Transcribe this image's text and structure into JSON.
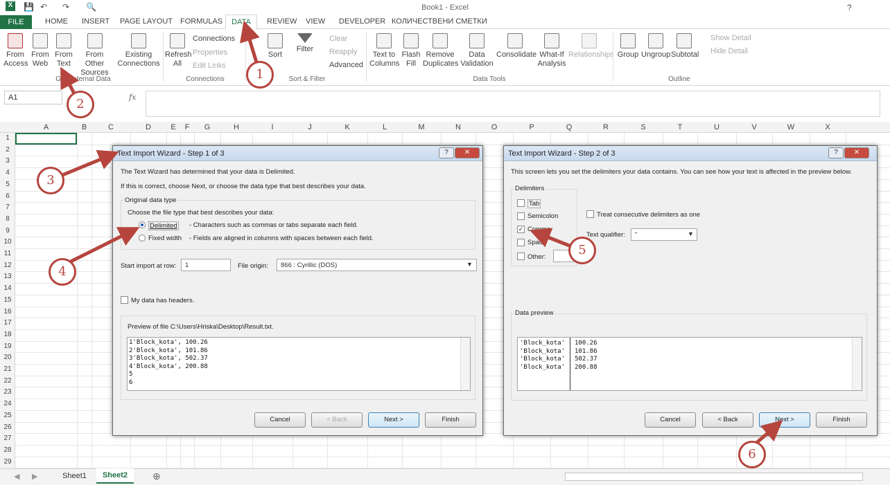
{
  "title": "Book1 - Excel",
  "help_glyph": "?",
  "tabs": [
    "FILE",
    "HOME",
    "INSERT",
    "PAGE LAYOUT",
    "FORMULAS",
    "DATA",
    "REVIEW",
    "VIEW",
    "DEVELOPER",
    "КОЛИЧЕСТВЕНИ СМЕТКИ"
  ],
  "ribbon": {
    "get_external": {
      "from_access": "From\nAccess",
      "from_web": "From\nWeb",
      "from_text": "From\nText",
      "from_other": "From Other\nSources",
      "existing": "Existing\nConnections",
      "group": "Get External Data"
    },
    "connections": {
      "refresh": "Refresh\nAll",
      "connections": "Connections",
      "properties": "Properties",
      "edit_links": "Edit Links",
      "group": "Connections"
    },
    "sort_filter": {
      "sort": "Sort",
      "filter": "Filter",
      "clear": "Clear",
      "reapply": "Reapply",
      "advanced": "Advanced",
      "group": "Sort & Filter"
    },
    "data_tools": {
      "text_to_columns": "Text to\nColumns",
      "flash_fill": "Flash\nFill",
      "remove_dup": "Remove\nDuplicates",
      "data_validation": "Data\nValidation",
      "consolidate": "Consolidate",
      "what_if": "What-If\nAnalysis",
      "relationships": "Relationships",
      "group": "Data Tools"
    },
    "outline": {
      "group_btn": "Group",
      "ungroup": "Ungroup",
      "subtotal": "Subtotal",
      "show_detail": "Show Detail",
      "hide_detail": "Hide Detail",
      "group": "Outline"
    }
  },
  "namebox": "A1",
  "fx": "fx",
  "columns": [
    "A",
    "B",
    "C",
    "D",
    "E",
    "F",
    "G",
    "H",
    "I",
    "J",
    "K",
    "L",
    "M",
    "N",
    "O",
    "P",
    "Q",
    "R",
    "S",
    "T",
    "U",
    "V",
    "W",
    "X"
  ],
  "rows": [
    "1",
    "2",
    "3",
    "4",
    "5",
    "6",
    "7",
    "8",
    "9",
    "10",
    "11",
    "12",
    "13",
    "14",
    "15",
    "16",
    "17",
    "18",
    "19",
    "20",
    "21",
    "22",
    "23",
    "24",
    "25",
    "26",
    "27",
    "28",
    "29"
  ],
  "sheets": [
    "Sheet1",
    "Sheet2"
  ],
  "add_sheet": "⊕",
  "dialog1": {
    "title": "Text Import Wizard - Step 1 of 3",
    "line1": "The Text Wizard has determined that your data is Delimited.",
    "line2": "If this is correct, choose Next, or choose the data type that best describes your data.",
    "frame": "Original data type",
    "choose": "Choose the file type that best describes your data:",
    "opt1": "Delimited",
    "opt1_desc": "- Characters such as commas or tabs separate each field.",
    "opt2": "Fixed width",
    "opt2_desc": "- Fields are aligned in columns with spaces between each field.",
    "start_label": "Start import at row:",
    "start_value": "1",
    "origin_label": "File origin:",
    "origin_value": "866 : Cyrillic (DOS)",
    "headers": "My data has headers.",
    "preview_label": "Preview of file C:\\Users\\Hriska\\Desktop\\Result.txt.",
    "preview_lines": [
      "1'Block_kota', 100.26",
      "2'Block_kota', 101.86",
      "3'Block_kota', 502.37",
      "4'Block_kota', 200.88",
      "5",
      "6"
    ],
    "cancel": "Cancel",
    "back": "< Back",
    "next": "Next >",
    "finish": "Finish"
  },
  "dialog2": {
    "title": "Text Import Wizard - Step 2 of 3",
    "line1": "This screen lets you set the delimiters your data contains.  You can see how your text is affected in the preview below.",
    "delims": "Delimiters",
    "tab": "Tab",
    "semicolon": "Semicolon",
    "comma": "Comma",
    "space": "Space",
    "other": "Other:",
    "consecutive": "Treat consecutive delimiters as one",
    "qualifier_label": "Text qualifier:",
    "qualifier_value": "\"",
    "preview_label": "Data preview",
    "col1": [
      "'Block_kota'",
      "'Block_kota'",
      "'Block_kota'",
      "'Block_kota'"
    ],
    "col2": [
      "100.26",
      "101.86",
      "502.37",
      "200.88"
    ],
    "cancel": "Cancel",
    "back": "< Back",
    "next": "Next >",
    "finish": "Finish"
  },
  "markers": [
    "1",
    "2",
    "3",
    "4",
    "5",
    "6"
  ],
  "colors": {
    "accent": "#217346",
    "marker": "#b5453e"
  }
}
